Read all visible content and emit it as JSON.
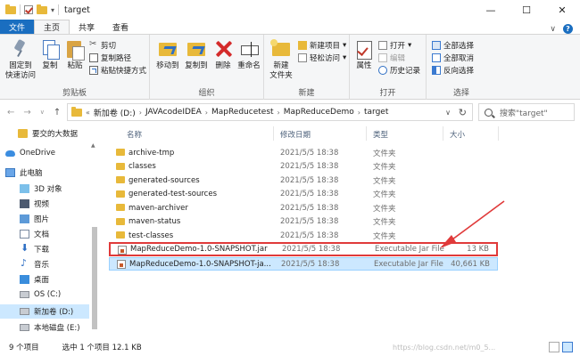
{
  "window": {
    "title": "target",
    "controls": {
      "minimize": "—",
      "maximize": "☐",
      "close": "✕"
    }
  },
  "tabs": {
    "file": "文件",
    "home": "主页",
    "share": "共享",
    "view": "查看",
    "expand": "∨"
  },
  "ribbon": {
    "clipboard": {
      "pin": "固定到\n快速访问",
      "copy": "复制",
      "paste": "粘贴",
      "cut": "剪切",
      "copy_path": "复制路径",
      "paste_shortcut": "粘贴快捷方式",
      "label": "剪贴板"
    },
    "organize": {
      "move_to": "移动到",
      "copy_to": "复制到",
      "delete": "删除",
      "rename": "重命名",
      "label": "组织"
    },
    "new": {
      "new_folder": "新建\n文件夹",
      "new_item": "新建项目",
      "easy_access": "轻松访问",
      "label": "新建"
    },
    "open": {
      "properties": "属性",
      "open": "打开",
      "edit": "编辑",
      "history": "历史记录",
      "label": "打开"
    },
    "select": {
      "select_all": "全部选择",
      "select_none": "全部取消",
      "invert": "反向选择",
      "label": "选择"
    }
  },
  "address": {
    "crumbs": [
      "新加卷 (D:)",
      "JAVAcodeIDEA",
      "MapReducetest",
      "MapReduceDemo",
      "target"
    ],
    "search_placeholder": "搜索\"target\""
  },
  "nav_pane": {
    "items": [
      {
        "label": "要交的大数据",
        "icon": "folder-icon"
      },
      {
        "label": "OneDrive",
        "icon": "onedrive-icon"
      },
      {
        "label": "此电脑",
        "icon": "this-pc-icon"
      },
      {
        "label": "3D 对象",
        "icon": "3d-objects-icon"
      },
      {
        "label": "视频",
        "icon": "video-icon"
      },
      {
        "label": "图片",
        "icon": "pictures-icon"
      },
      {
        "label": "文档",
        "icon": "documents-icon"
      },
      {
        "label": "下载",
        "icon": "downloads-icon"
      },
      {
        "label": "音乐",
        "icon": "music-icon"
      },
      {
        "label": "桌面",
        "icon": "desktop-icon"
      },
      {
        "label": "OS (C:)",
        "icon": "drive-icon"
      },
      {
        "label": "新加卷 (D:)",
        "icon": "drive-icon"
      },
      {
        "label": "本地磁盘 (E:)",
        "icon": "drive-icon"
      }
    ]
  },
  "file_list": {
    "columns": {
      "name": "名称",
      "date": "修改日期",
      "type": "类型",
      "size": "大小"
    },
    "rows": [
      {
        "name": "archive-tmp",
        "date": "2021/5/5 18:38",
        "type": "文件夹",
        "size": "",
        "kind": "folder"
      },
      {
        "name": "classes",
        "date": "2021/5/5 18:38",
        "type": "文件夹",
        "size": "",
        "kind": "folder"
      },
      {
        "name": "generated-sources",
        "date": "2021/5/5 18:38",
        "type": "文件夹",
        "size": "",
        "kind": "folder"
      },
      {
        "name": "generated-test-sources",
        "date": "2021/5/5 18:38",
        "type": "文件夹",
        "size": "",
        "kind": "folder"
      },
      {
        "name": "maven-archiver",
        "date": "2021/5/5 18:38",
        "type": "文件夹",
        "size": "",
        "kind": "folder"
      },
      {
        "name": "maven-status",
        "date": "2021/5/5 18:38",
        "type": "文件夹",
        "size": "",
        "kind": "folder"
      },
      {
        "name": "test-classes",
        "date": "2021/5/5 18:38",
        "type": "文件夹",
        "size": "",
        "kind": "folder"
      },
      {
        "name": "MapReduceDemo-1.0-SNAPSHOT.jar",
        "date": "2021/5/5 18:38",
        "type": "Executable Jar File",
        "size": "13 KB",
        "kind": "jar"
      },
      {
        "name": "MapReduceDemo-1.0-SNAPSHOT-ja...",
        "date": "2021/5/5 18:38",
        "type": "Executable Jar File",
        "size": "40,661 KB",
        "kind": "jar"
      }
    ]
  },
  "status": {
    "count": "9 个项目",
    "selection": "选中 1 个项目  12.1 KB",
    "watermark": "https://blog.csdn.net/m0_5..."
  },
  "colors": {
    "accent": "#1a6ec0",
    "selection": "#cce8ff",
    "annotation": "#e03a3a"
  }
}
